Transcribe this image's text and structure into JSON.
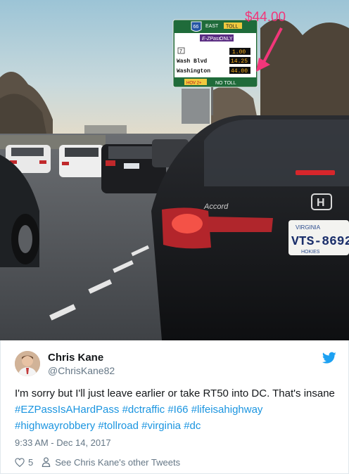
{
  "photo": {
    "overlay_price": "$44.00",
    "sign": {
      "route_number": "66",
      "direction": "EAST",
      "toll_label": "TOLL",
      "ezpass_label": "E-ZPass",
      "only_label": "ONLY",
      "exit_number": "7",
      "first_amount": "1.00",
      "rows": [
        {
          "label": "Wash Blvd",
          "amount": "14.25"
        },
        {
          "label": "Washington",
          "amount": "44.00"
        }
      ],
      "hov_label": "HOV 2+",
      "no_toll_label": "NO TOLL"
    },
    "car_badge": "Accord",
    "plate_state": "VIRGINIA",
    "plate_number": "VTS-8692",
    "plate_bottom": "HOKIES"
  },
  "tweet": {
    "author_name": "Chris Kane",
    "author_handle": "@ChrisKane82",
    "text_intro": "I'm sorry but I'll just leave earlier or take RT50 into DC. That's insane ",
    "hashtags": [
      "#EZPassIsAHardPass",
      "#dctraffic",
      "#I66",
      "#lifeisahighway",
      "#highwayrobbery",
      "#tollroad",
      "#virginia",
      "#dc"
    ],
    "timestamp": "9:33 AM - Dec 14, 2017",
    "like_count": "5",
    "other_tweets_link": "See Chris Kane's other Tweets"
  },
  "colors": {
    "link": "#1b95e0",
    "secondary_text": "#657786",
    "annotation": "#f2367a",
    "sign_green": "#1f6b3a"
  },
  "icons": [
    "twitter-bird-icon",
    "heart-icon",
    "person-icon"
  ]
}
